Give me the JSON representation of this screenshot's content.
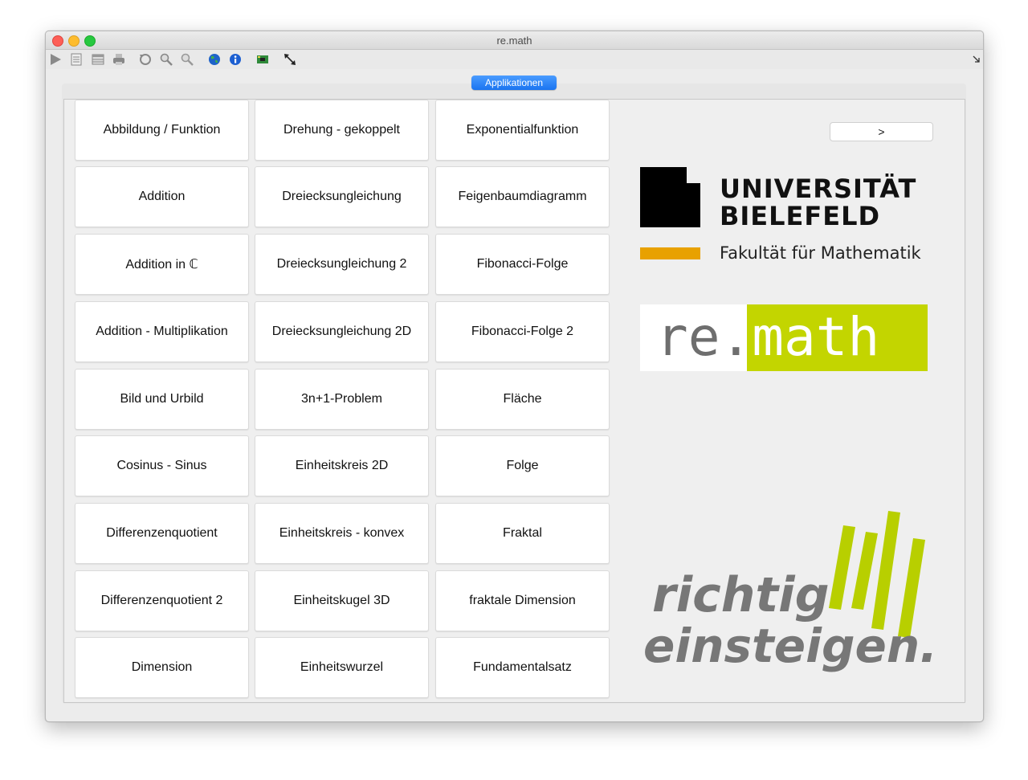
{
  "window": {
    "title": "re.math"
  },
  "toolbar": {
    "icons": [
      "play-icon",
      "document-icon",
      "table-icon",
      "print-icon",
      "refresh-icon",
      "zoom-in-icon",
      "zoom-out-icon",
      "globe-icon",
      "info-icon",
      "chip-icon",
      "resize-arrows-icon"
    ]
  },
  "tab": {
    "label": "Applikationen"
  },
  "nav": {
    "next_label": ">"
  },
  "apps": {
    "columns": [
      [
        "Abbildung / Funktion",
        "Addition",
        "Addition in ℂ",
        "Addition - Multiplikation",
        "Bild und Urbild",
        "Cosinus - Sinus",
        "Differenzenquotient",
        "Differenzenquotient 2",
        "Dimension"
      ],
      [
        "Drehung - gekoppelt",
        "Dreiecksungleichung",
        "Dreiecksungleichung 2",
        "Dreiecksungleichung 2D",
        "3n+1-Problem",
        "Einheitskreis 2D",
        "Einheitskreis - konvex",
        "Einheitskugel 3D",
        "Einheitswurzel"
      ],
      [
        "Exponentialfunktion",
        "Feigenbaumdiagramm",
        "Fibonacci-Folge",
        "Fibonacci-Folge 2",
        "Fläche",
        "Folge",
        "Fraktal",
        "fraktale Dimension",
        "Fundamentalsatz"
      ]
    ]
  },
  "logos": {
    "university": {
      "line1": "UNIVERSITÄT",
      "line2": "BIELEFELD",
      "faculty": "Fakultät für Mathematik",
      "orange": "#e8a100"
    },
    "remath": {
      "part1": "re",
      "dot": ".",
      "part2": "math",
      "green": "#c3d500",
      "gray": "#6e6e6e"
    },
    "slogan": {
      "line1": "richtig",
      "line2": "einsteigen.",
      "green": "#b8cf00",
      "gray": "#777777"
    }
  }
}
